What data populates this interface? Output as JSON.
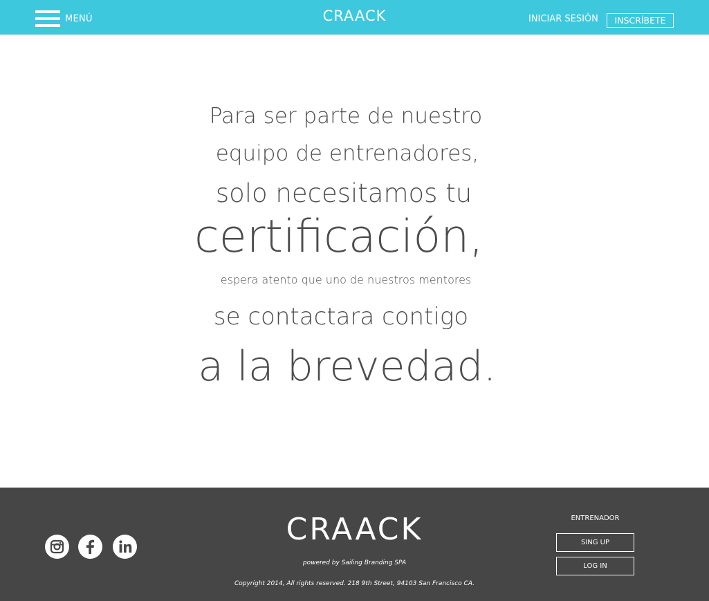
{
  "header": {
    "menu_label": "MENÚ",
    "logo": "CRAACK",
    "login_label": "INICIAR SESIÓN",
    "signup_label": "INSCRÍBETE"
  },
  "message": {
    "line1": "Para ser parte de nuestro",
    "line2": "equipo de entrenadores,",
    "line3": "solo necesitamos tu",
    "line4": "certificación,",
    "line5": "espera atento que uno de nuestros mentores",
    "line6": "se contactara contigo",
    "line7": "a la brevedad."
  },
  "footer": {
    "logo": "CRAACK",
    "powered": "powered by Sailing Branding SPA",
    "copyright": "Copyright 2014, All rights reserved. 218 9th Street, 94103 San Francisco CA.",
    "trainer_title": "ENTRENADOR",
    "signup_label": "SING UP",
    "login_label": "LOG IN",
    "social_icons": [
      "instagram-icon",
      "facebook-icon",
      "linkedin-icon"
    ]
  },
  "colors": {
    "header_bg": "#3ec8de",
    "footer_bg": "#464646",
    "text": "#4d4d4d"
  }
}
